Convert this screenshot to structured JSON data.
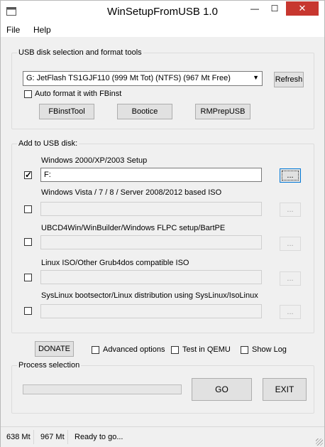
{
  "window": {
    "title": "WinSetupFromUSB 1.0",
    "controls": {
      "minimize": "—",
      "maximize": "☐",
      "close": "✕"
    }
  },
  "menu": [
    "File",
    "Help"
  ],
  "usb_group": {
    "label": "USB disk selection and format tools",
    "selected_disk": "G: JetFlash TS1GJF110 (999 Mt Tot) (NTFS) (967 Mt Free)",
    "refresh_label": "Refresh",
    "auto_format_label": "Auto format it with FBinst",
    "auto_format_checked": false,
    "tools": [
      "FBinstTool",
      "Bootice",
      "RMPrepUSB"
    ]
  },
  "add_group": {
    "label": "Add to USB disk:",
    "browse_label": "...",
    "entries": [
      {
        "label": "Windows 2000/XP/2003 Setup",
        "checked": true,
        "value": "F:",
        "enabled": true
      },
      {
        "label": "Windows Vista / 7 / 8 / Server 2008/2012 based ISO",
        "checked": false,
        "value": "",
        "enabled": false
      },
      {
        "label": "UBCD4Win/WinBuilder/Windows FLPC setup/BartPE",
        "checked": false,
        "value": "",
        "enabled": false
      },
      {
        "label": "Linux ISO/Other Grub4dos compatible ISO",
        "checked": false,
        "value": "",
        "enabled": false
      },
      {
        "label": "SysLinux bootsector/Linux distribution using SysLinux/IsoLinux",
        "checked": false,
        "value": "",
        "enabled": false
      }
    ]
  },
  "options": {
    "donate_label": "DONATE",
    "advanced_label": "Advanced options",
    "qemu_label": "Test in QEMU",
    "showlog_label": "Show Log"
  },
  "process": {
    "label": "Process selection",
    "progress": 0,
    "go_label": "GO",
    "exit_label": "EXIT"
  },
  "status": {
    "disk_size": "638 Mt",
    "free_size": "967 Mt",
    "message": "Ready to go..."
  }
}
